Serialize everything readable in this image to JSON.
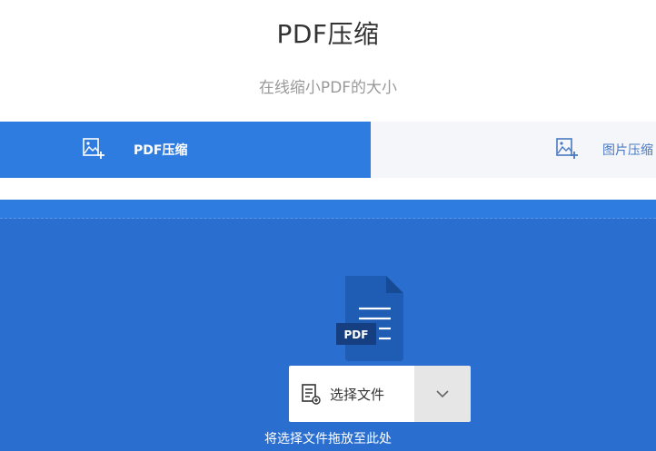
{
  "header": {
    "title": "PDF压缩",
    "subtitle": "在线缩小PDF的大小"
  },
  "tabs": [
    {
      "label": "PDF压缩",
      "icon": "image-plus-icon",
      "active": true
    },
    {
      "label": "图片压缩",
      "icon": "image-plus-icon",
      "active": false
    }
  ],
  "upload": {
    "graphic_badge": "PDF",
    "select_label": "选择文件",
    "drop_hint": "将选择文件拖放至此处"
  },
  "colors": {
    "accent": "#2f7ce0",
    "dropzone": "#2a6fd0",
    "inactive_tab": "#f4f6f9"
  }
}
